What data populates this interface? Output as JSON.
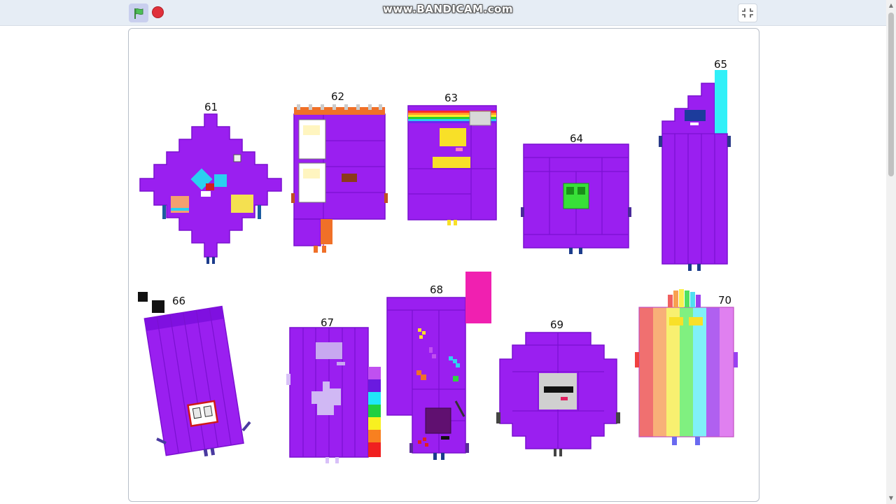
{
  "toolbar": {
    "watermark": "www.BANDICAM.com",
    "flag_icon": "green-flag-icon",
    "stop_icon": "stop-sign-icon",
    "fullscreen_icon": "exit-fullscreen-icon"
  },
  "stage": {
    "characters": [
      {
        "label": "61"
      },
      {
        "label": "62"
      },
      {
        "label": "63"
      },
      {
        "label": "64"
      },
      {
        "label": "65"
      },
      {
        "label": "66"
      },
      {
        "label": "67"
      },
      {
        "label": "68"
      },
      {
        "label": "69"
      },
      {
        "label": "70"
      }
    ]
  },
  "colors": {
    "body": "#9a1ff0",
    "outline": "#7a10d0",
    "topbar": "#e6edf5",
    "flag": "#4cbf56",
    "stop": "#e0303a"
  }
}
